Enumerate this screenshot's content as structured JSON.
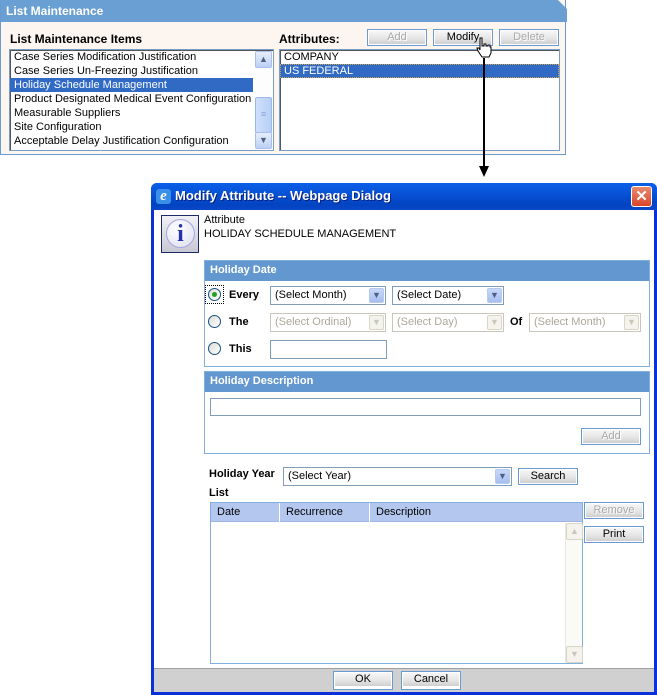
{
  "list_maintenance": {
    "title": "List Maintenance",
    "items_label": "List Maintenance Items",
    "attributes_label": "Attributes:",
    "items": [
      {
        "label": "Case Series Modification Justification",
        "selected": false
      },
      {
        "label": "Case Series Un-Freezing Justification",
        "selected": false
      },
      {
        "label": "Holiday Schedule Management",
        "selected": true
      },
      {
        "label": "Product Designated Medical Event Configuration",
        "selected": false
      },
      {
        "label": "Measurable Suppliers",
        "selected": false
      },
      {
        "label": "Site Configuration",
        "selected": false
      },
      {
        "label": "Acceptable Delay Justification Configuration",
        "selected": false
      }
    ],
    "attributes": [
      {
        "label": "COMPANY",
        "selected": false
      },
      {
        "label": "US FEDERAL",
        "selected": true
      }
    ],
    "buttons": {
      "add": {
        "label": "Add",
        "enabled": false
      },
      "modify": {
        "label": "Modify",
        "enabled": true
      },
      "delete": {
        "label": "Delete",
        "enabled": false
      }
    },
    "icons": {
      "scroll_up": "▲",
      "scroll_down": "▼",
      "thumb_grip": "≡"
    }
  },
  "dialog": {
    "title": "Modify Attribute -- Webpage Dialog",
    "close_glyph": "✕",
    "app_icon": "e",
    "info_glyph": "i",
    "attribute_label": "Attribute",
    "attribute_value": "HOLIDAY SCHEDULE MANAGEMENT",
    "holiday_date": {
      "header": "Holiday Date",
      "options": [
        {
          "label": "Every",
          "checked": true
        },
        {
          "label": "The",
          "checked": false
        },
        {
          "label": "This",
          "checked": false
        }
      ],
      "every_month": "(Select Month)",
      "every_date": "(Select Date)",
      "the_ordinal": "(Select Ordinal)",
      "the_day": "(Select Day)",
      "of_label": "Of",
      "the_month": "(Select Month)",
      "this_value": ""
    },
    "holiday_description": {
      "header": "Holiday Description",
      "value": "",
      "add_label": "Add"
    },
    "holiday_year_label": "Holiday Year",
    "holiday_year_value": "(Select Year)",
    "search_label": "Search",
    "list_label": "List",
    "list_columns": [
      "Date",
      "Recurrence",
      "Description"
    ],
    "list_rows": [],
    "remove_label": "Remove",
    "print_label": "Print",
    "ok_label": "OK",
    "cancel_label": "Cancel",
    "dropdown_glyph": "▼"
  }
}
